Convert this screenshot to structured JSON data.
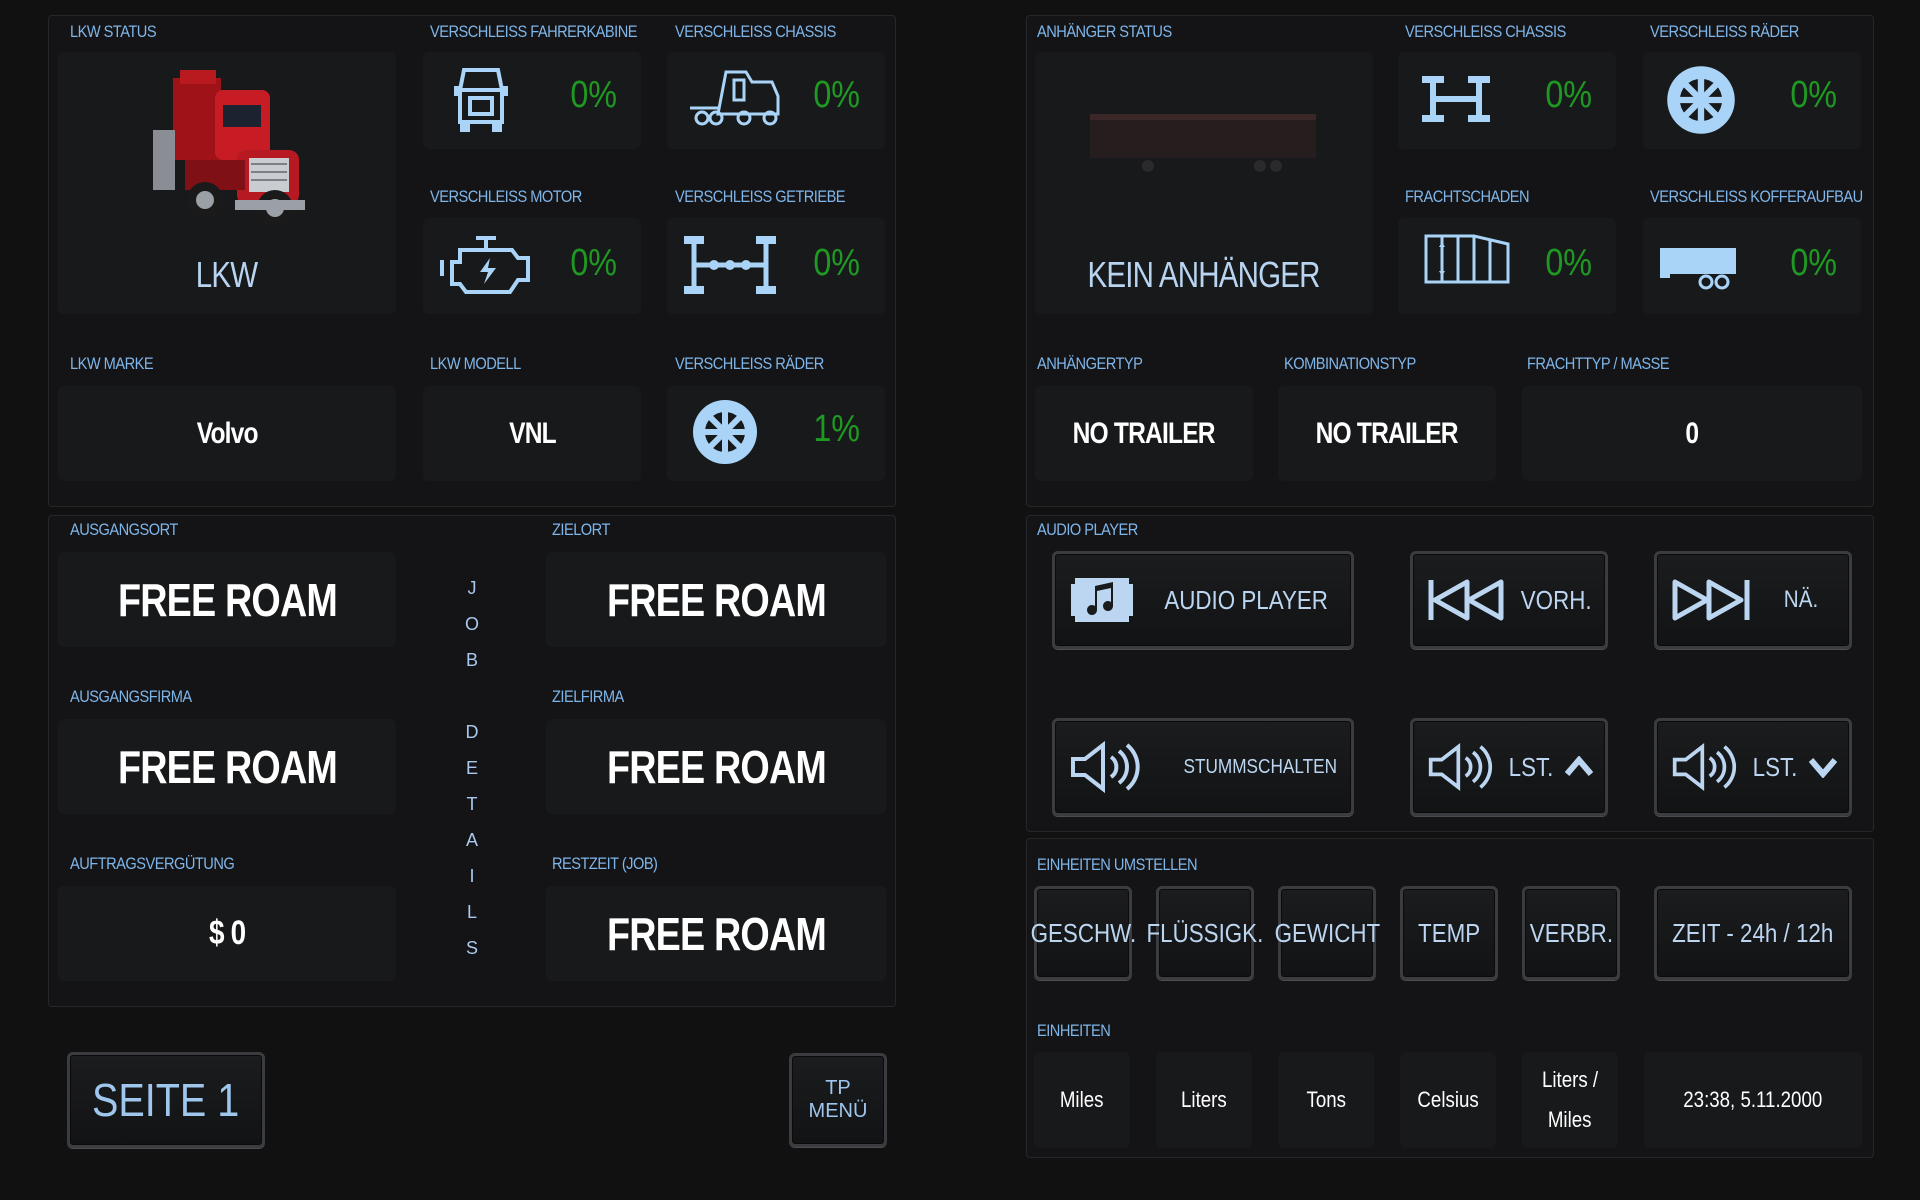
{
  "truck": {
    "status_label": "LKW STATUS",
    "name": "LKW",
    "cabin_label": "VERSCHLEISS FAHRERKABINE",
    "cabin_value": "0%",
    "chassis_label": "VERSCHLEISS CHASSIS",
    "chassis_value": "0%",
    "engine_label": "VERSCHLEISS MOTOR",
    "engine_value": "0%",
    "gearbox_label": "VERSCHLEISS GETRIEBE",
    "gearbox_value": "0%",
    "brand_label": "LKW MARKE",
    "brand_value": "Volvo",
    "model_label": "LKW MODELL",
    "model_value": "VNL",
    "wheels_label": "VERSCHLEISS RÄDER",
    "wheels_value": "1%"
  },
  "trailer": {
    "status_label": "ANHÄNGER STATUS",
    "status_value": "KEIN ANHÄNGER",
    "chassis_label": "VERSCHLEISS CHASSIS",
    "chassis_value": "0%",
    "wheels_label": "VERSCHLEISS RÄDER",
    "wheels_value": "0%",
    "cargo_damage_label": "FRACHTSCHADEN",
    "cargo_damage_value": "0%",
    "body_label": "VERSCHLEISS KOFFERAUFBAU",
    "body_value": "0%",
    "type_label": "ANHÄNGERTYP",
    "type_value": "NO TRAILER",
    "combo_label": "KOMBINATIONSTYP",
    "combo_value": "NO TRAILER",
    "cargo_label": "FRACHTTYP / MASSE",
    "cargo_value": "0"
  },
  "job": {
    "origin_label": "AUSGANGSORT",
    "origin_value": "FREE ROAM",
    "dest_label": "ZIELORT",
    "dest_value": "FREE ROAM",
    "origin_company_label": "AUSGANGSFIRMA",
    "origin_company_value": "FREE ROAM",
    "dest_company_label": "ZIELFIRMA",
    "dest_company_value": "FREE ROAM",
    "income_label": "AUFTRAGSVERGÜTUNG",
    "income_value": "$ 0",
    "remaining_label": "RESTZEIT (JOB)",
    "remaining_value": "FREE ROAM",
    "vertical_letters": [
      "J",
      "O",
      "B",
      "",
      "D",
      "E",
      "T",
      "A",
      "I",
      "L",
      "S"
    ]
  },
  "audio": {
    "section_label": "AUDIO PLAYER",
    "player_label": "AUDIO PLAYER",
    "prev_label": "VORH.",
    "next_label": "NÄ.",
    "mute_label": "STUMMSCHALTEN",
    "vol_up_label": "LST.",
    "vol_down_label": "LST."
  },
  "units": {
    "switch_label": "EINHEITEN UMSTELLEN",
    "speed_btn": "GESCHW.",
    "fluid_btn": "FLÜSSIGK.",
    "weight_btn": "GEWICHT",
    "temp_btn": "TEMP",
    "consumption_btn": "VERBR.",
    "time_btn": "ZEIT - 24h / 12h",
    "current_label": "EINHEITEN",
    "speed_val": "Miles",
    "fluid_val": "Liters",
    "weight_val": "Tons",
    "temp_val": "Celsius",
    "consumption_val_1": "Liters /",
    "consumption_val_2": "Miles",
    "time_val": "23:38, 5.11.2000"
  },
  "nav": {
    "page_btn": "SEITE 1",
    "tp_line1": "TP",
    "tp_line2": "MENÜ"
  },
  "colors": {
    "accent_label": "#7fb6ea",
    "percent_green": "#1e9a22",
    "icon_blue": "#a9d4f7"
  }
}
